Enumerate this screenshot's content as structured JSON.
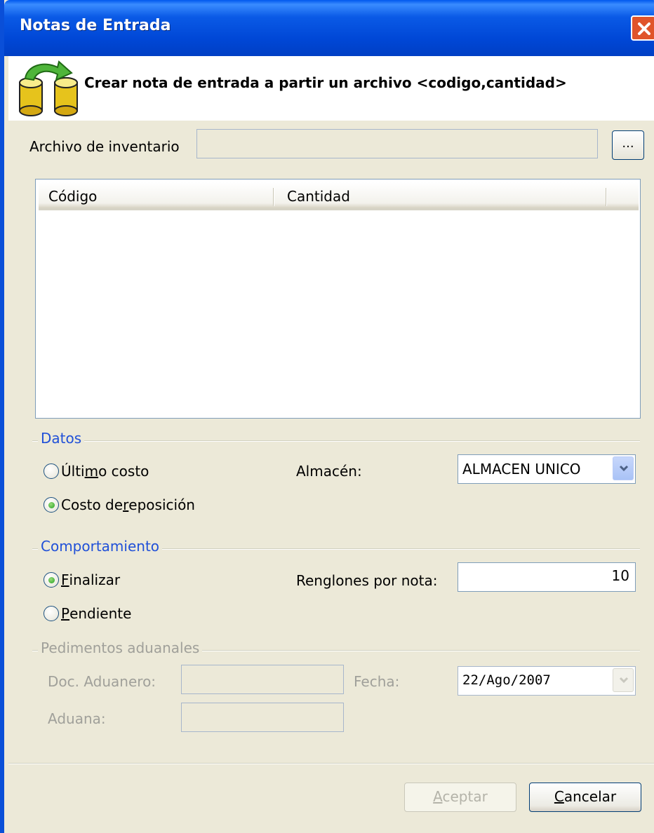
{
  "window": {
    "title": "Notas de Entrada"
  },
  "header": {
    "text": "Crear nota de entrada a partir un archivo <codigo,cantidad>"
  },
  "archivo": {
    "label": "Archivo de inventario",
    "value": "",
    "browse_label": "..."
  },
  "table": {
    "columns": [
      "Código",
      "Cantidad"
    ],
    "rows": []
  },
  "datos": {
    "title": "Datos",
    "radio1": {
      "before": "Últi",
      "mnemonic": "m",
      "after": "o costo",
      "checked": false
    },
    "radio2": {
      "before": "Costo de ",
      "mnemonic": "r",
      "after": "eposición",
      "checked": true
    },
    "almacen_label": "Almacén:",
    "almacen_value": "ALMACEN UNICO"
  },
  "comportamiento": {
    "title": "Comportamiento",
    "radio1": {
      "mnemonic": "F",
      "after": "inalizar",
      "checked": true
    },
    "radio2": {
      "mnemonic": "P",
      "after": "endiente",
      "checked": false
    },
    "renglones_label": "Renglones por nota:",
    "renglones_value": "10"
  },
  "pedimentos": {
    "title": "Pedimentos aduanales",
    "doc_label": "Doc. Aduanero:",
    "doc_value": "",
    "fecha_label": "Fecha:",
    "fecha_value": "22/Ago/2007",
    "aduana_label": "Aduana:",
    "aduana_value": ""
  },
  "buttons": {
    "aceptar": {
      "mnemonic": "A",
      "after": "ceptar"
    },
    "cancelar": {
      "mnemonic": "C",
      "after": "ancelar"
    }
  },
  "colors": {
    "titlebar": "#0054e3",
    "group_title": "#2050d8",
    "dialog_bg": "#ece9d8"
  }
}
